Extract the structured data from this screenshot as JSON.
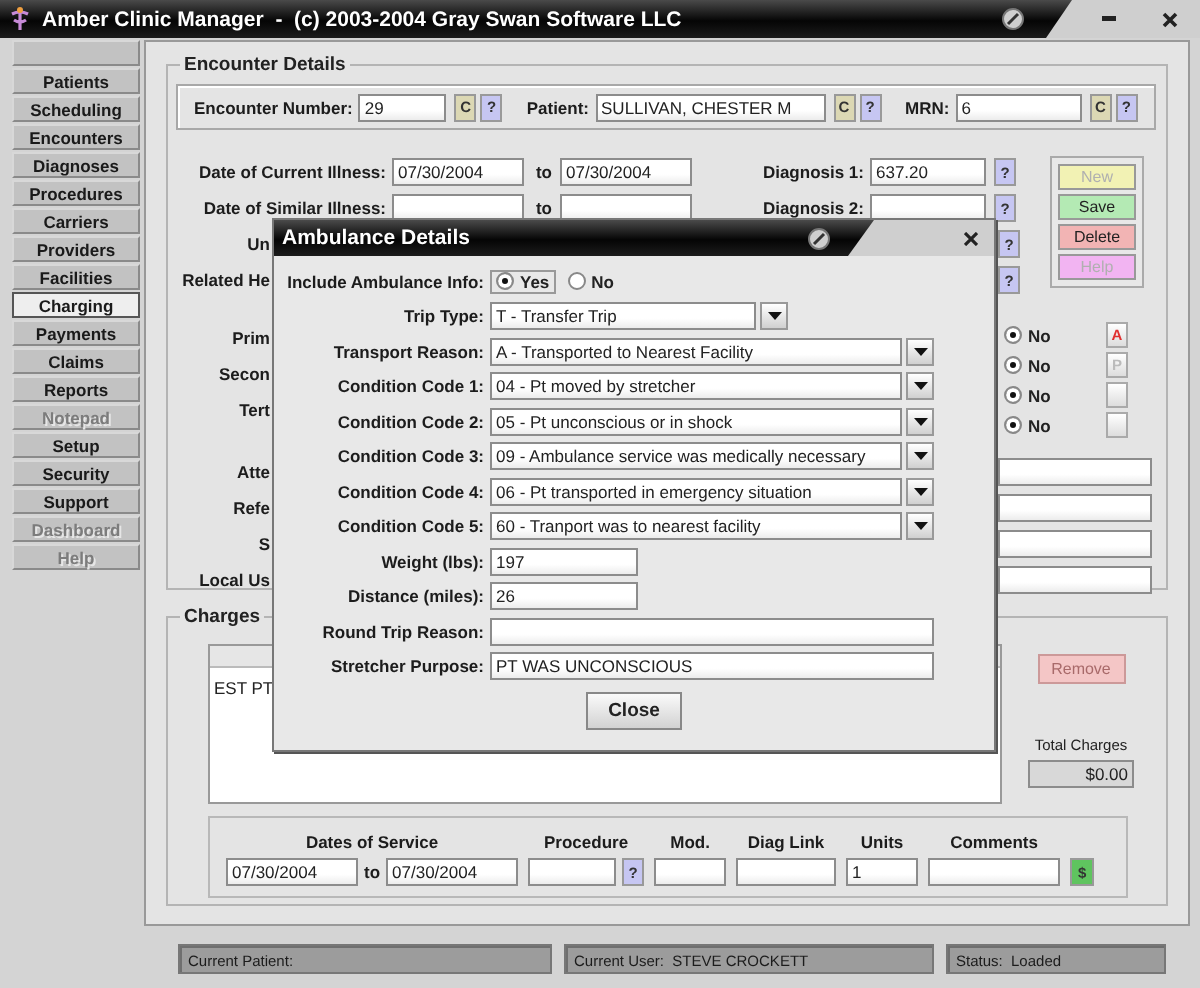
{
  "window": {
    "title": "Amber Clinic Manager  -  (c) 2003-2004 Gray Swan Software LLC"
  },
  "sidebar": {
    "items": [
      {
        "kind": "blank",
        "selected": false
      },
      {
        "kind": "nav",
        "label": "Patients",
        "selected": false,
        "disabled": false
      },
      {
        "kind": "nav",
        "label": "Scheduling",
        "selected": false,
        "disabled": false
      },
      {
        "kind": "nav",
        "label": "Encounters",
        "selected": false,
        "disabled": false
      },
      {
        "kind": "nav",
        "label": "Diagnoses",
        "selected": false,
        "disabled": false
      },
      {
        "kind": "nav",
        "label": "Procedures",
        "selected": false,
        "disabled": false
      },
      {
        "kind": "nav",
        "label": "Carriers",
        "selected": false,
        "disabled": false
      },
      {
        "kind": "nav",
        "label": "Providers",
        "selected": false,
        "disabled": false
      },
      {
        "kind": "nav",
        "label": "Facilities",
        "selected": false,
        "disabled": false
      },
      {
        "kind": "nav",
        "label": "Charging",
        "selected": true,
        "disabled": false
      },
      {
        "kind": "nav",
        "label": "Payments",
        "selected": false,
        "disabled": false
      },
      {
        "kind": "nav",
        "label": "Claims",
        "selected": false,
        "disabled": false
      },
      {
        "kind": "nav",
        "label": "Reports",
        "selected": false,
        "disabled": false
      },
      {
        "kind": "nav",
        "label": "Notepad",
        "selected": false,
        "disabled": true
      },
      {
        "kind": "nav",
        "label": "Setup",
        "selected": false,
        "disabled": false
      },
      {
        "kind": "nav",
        "label": "Security",
        "selected": false,
        "disabled": false
      },
      {
        "kind": "nav",
        "label": "Support",
        "selected": false,
        "disabled": false
      },
      {
        "kind": "nav",
        "label": "Dashboard",
        "selected": false,
        "disabled": true
      },
      {
        "kind": "nav",
        "label": "Help",
        "selected": false,
        "disabled": true
      }
    ]
  },
  "encounter_details": {
    "title": "Encounter Details",
    "header": [
      {
        "label": "Encounter Number:",
        "value": "29",
        "clear_button": "C",
        "lookup_button": "?"
      },
      {
        "label": "Patient:",
        "value": "SULLIVAN, CHESTER M",
        "clear_button": "C",
        "lookup_button": "?"
      },
      {
        "label": "MRN:",
        "value": "6",
        "clear_button": "C",
        "lookup_button": "?"
      }
    ],
    "rows": [
      {
        "kind": "dates_diagnosis",
        "label": "Date of Current Illness:",
        "from": "07/30/2004",
        "to_label": "to",
        "to": "07/30/2004",
        "diagnosis_label": "Diagnosis 1:",
        "diagnosis": "637.20",
        "lookup_button": "?"
      },
      {
        "kind": "dates_diagnosis",
        "label": "Date of Similar Illness:",
        "to_label": "to",
        "diagnosis_label": "Diagnosis 2:",
        "lookup_button": "?"
      },
      {
        "kind": "partial",
        "label": "Un",
        "lookup_button": "?"
      },
      {
        "kind": "partial",
        "label": "Related He",
        "lookup_button": "?"
      }
    ],
    "actions": [
      {
        "label": "New",
        "color": "#f2f2b4",
        "disabled": true
      },
      {
        "label": "Save",
        "color": "#b4eab4",
        "disabled": false
      },
      {
        "label": "Delete",
        "color": "#f2b4b4",
        "disabled": false
      },
      {
        "label": "Help",
        "color": "#f2b4f2",
        "disabled": true
      }
    ],
    "partial_labels": [
      [
        "Prim",
        "Secon",
        "Tert"
      ],
      [
        "Atte",
        "Refe",
        "S",
        "Local Us"
      ]
    ],
    "radio_rows": [
      {
        "label": "No",
        "selected": true,
        "side_button": {
          "kind": "lettered",
          "label": "A",
          "disabled": false
        }
      },
      {
        "label": "No",
        "selected": true,
        "side_button": {
          "kind": "lettered",
          "label": "P",
          "disabled": true
        }
      },
      {
        "label": "No",
        "selected": true,
        "side_button": {
          "kind": "blank"
        }
      },
      {
        "label": "No",
        "selected": true,
        "side_button": {
          "kind": "blank"
        }
      }
    ],
    "text_fields": [
      {
        "kind": "text"
      },
      {
        "kind": "text"
      },
      {
        "kind": "text"
      },
      {
        "kind": "text"
      }
    ]
  },
  "charges": {
    "title": "Charges",
    "table": {
      "rows": [
        [
          "EST PT"
        ]
      ]
    },
    "remove_button": {
      "label": "Remove",
      "disabled": true
    },
    "total": {
      "label": "Total Charges",
      "value": "$0.00"
    },
    "service_entry": {
      "columns": [
        "Dates of Service",
        "Procedure",
        "Mod.",
        "Diag Link",
        "Units",
        "Comments"
      ],
      "from": "07/30/2004",
      "to_label": "to",
      "to": "07/30/2004",
      "lookup_button": "?",
      "units": "1",
      "add_button": "$"
    }
  },
  "status_bar": [
    {
      "label": "Current Patient:"
    },
    {
      "label": "Current User:",
      "value": "STEVE CROCKETT"
    },
    {
      "label": "Status:",
      "value": "Loaded"
    }
  ],
  "ambulance_dialog": {
    "title": "Ambulance Details",
    "fields": [
      {
        "kind": "radio",
        "label": "Include Ambulance Info:",
        "options": [
          {
            "label": "Yes",
            "selected": true
          },
          {
            "label": "No",
            "selected": false
          }
        ]
      },
      {
        "kind": "short_select",
        "label": "Trip Type:",
        "value": "T - Transfer Trip"
      },
      {
        "kind": "select",
        "label": "Transport Reason:",
        "value": "A - Transported to Nearest Facility"
      },
      {
        "kind": "select",
        "label": "Condition Code 1:",
        "value": "04 - Pt moved by stretcher"
      },
      {
        "kind": "select",
        "label": "Condition Code 2:",
        "value": "05 - Pt unconscious or in shock"
      },
      {
        "kind": "select",
        "label": "Condition Code 3:",
        "value": "09 - Ambulance service was medically necessary"
      },
      {
        "kind": "select",
        "label": "Condition Code 4:",
        "value": "06 - Pt transported in emergency situation"
      },
      {
        "kind": "select",
        "label": "Condition Code 5:",
        "value": "60 - Tranport was to nearest facility"
      },
      {
        "kind": "short_text",
        "label": "Weight (lbs):",
        "value": "197"
      },
      {
        "kind": "short_text",
        "label": "Distance (miles):",
        "value": "26"
      },
      {
        "kind": "text",
        "label": "Round Trip Reason:"
      },
      {
        "kind": "text",
        "label": "Stretcher Purpose:",
        "value": "PT WAS UNCONSCIOUS"
      }
    ],
    "close_button": "Close"
  }
}
